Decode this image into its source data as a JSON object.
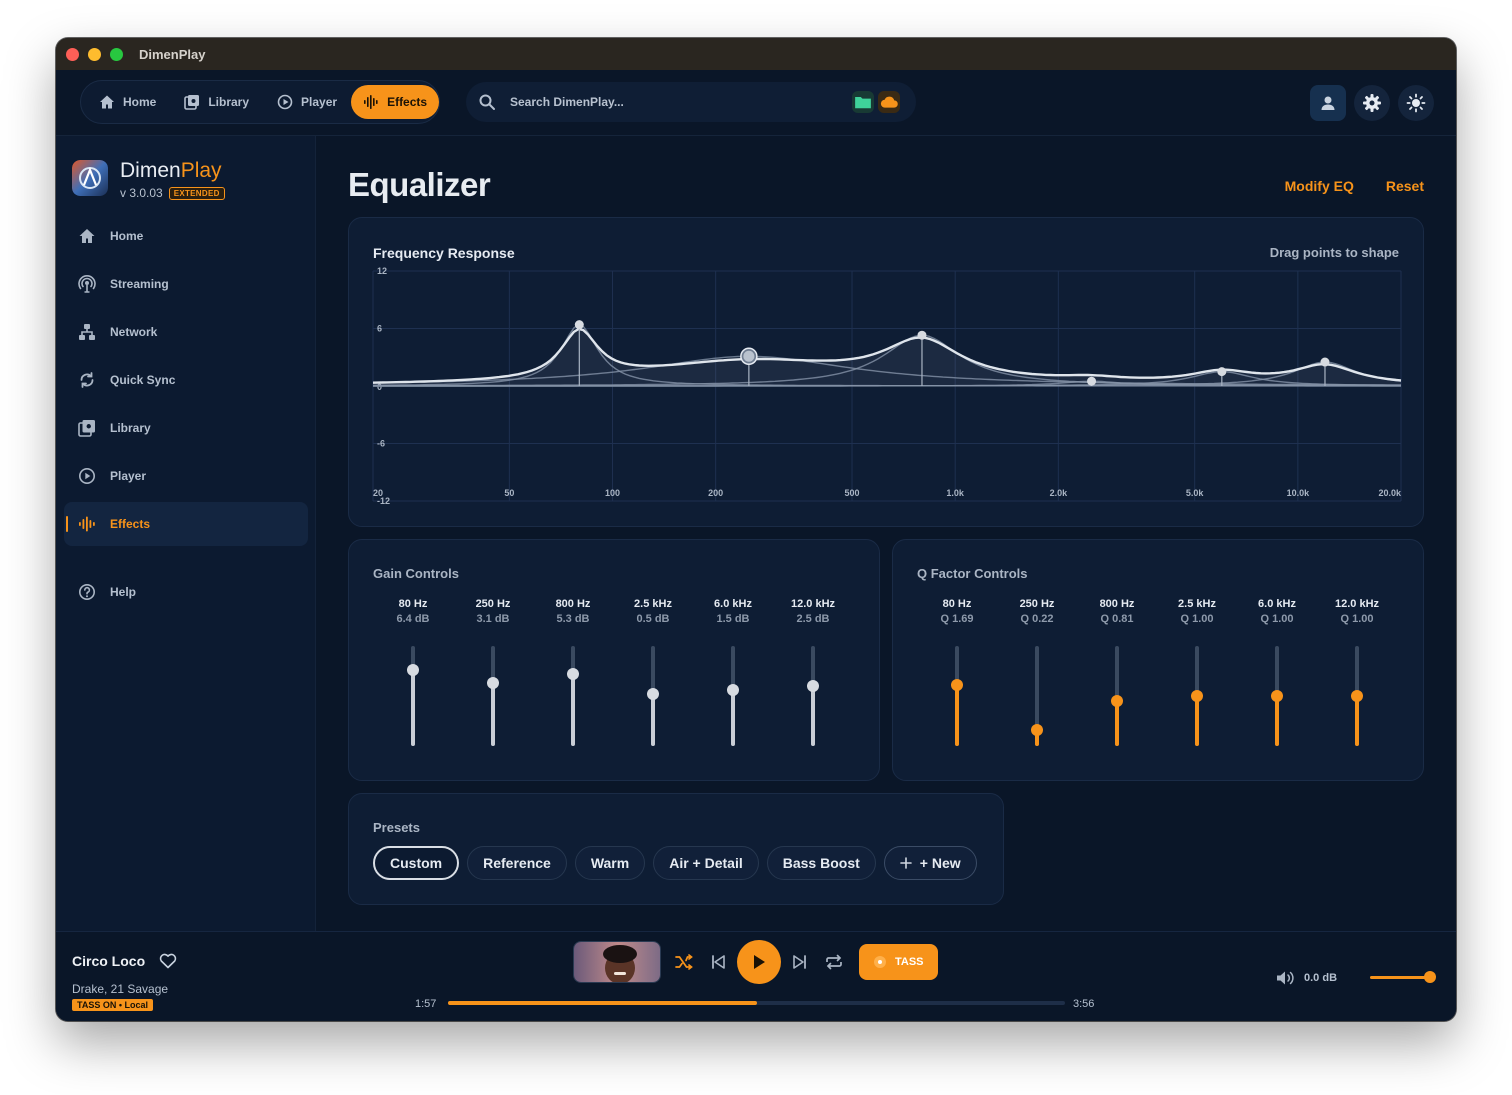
{
  "window": {
    "title": "DimenPlay"
  },
  "topnav": {
    "items": [
      {
        "label": "Home",
        "icon": "home-icon"
      },
      {
        "label": "Library",
        "icon": "library-icon"
      },
      {
        "label": "Player",
        "icon": "play-circle-icon"
      },
      {
        "label": "Effects",
        "icon": "waveform-icon",
        "active": true
      }
    ]
  },
  "search": {
    "placeholder": "Search DimenPlay..."
  },
  "brand": {
    "name_a": "Dimen",
    "name_b": "Play",
    "version": "v 3.0.03",
    "edition": "EXTENDED"
  },
  "sidebar": {
    "items": [
      {
        "label": "Home",
        "icon": "home-icon"
      },
      {
        "label": "Streaming",
        "icon": "broadcast-icon"
      },
      {
        "label": "Network",
        "icon": "network-icon"
      },
      {
        "label": "Quick Sync",
        "icon": "sync-icon"
      },
      {
        "label": "Library",
        "icon": "library-icon"
      },
      {
        "label": "Player",
        "icon": "play-circle-icon"
      },
      {
        "label": "Effects",
        "icon": "waveform-icon",
        "active": true
      },
      {
        "label": "Help",
        "icon": "help-icon"
      }
    ]
  },
  "page": {
    "title": "Equalizer",
    "modify": "Modify EQ",
    "reset": "Reset"
  },
  "freq": {
    "title": "Frequency Response",
    "hint": "Drag points to shape",
    "y_ticks": [
      "12",
      "6",
      "0",
      "-6",
      "-12"
    ],
    "x_ticks": [
      "20",
      "50",
      "100",
      "200",
      "500",
      "1.0k",
      "2.0k",
      "5.0k",
      "10.0k",
      "20.0k"
    ]
  },
  "chart_data": {
    "type": "line",
    "x_scale": "log",
    "xlim": [
      20,
      20000
    ],
    "ylim": [
      -12,
      12
    ],
    "y_ticks": [
      12,
      6,
      0,
      -6,
      -12
    ],
    "x_ticks": [
      20,
      50,
      100,
      200,
      500,
      1000,
      2000,
      5000,
      10000,
      20000
    ],
    "x_tick_labels": [
      "20",
      "50",
      "100",
      "200",
      "500",
      "1.0k",
      "2.0k",
      "5.0k",
      "10.0k",
      "20.0k"
    ],
    "grid": true,
    "bands": [
      {
        "freq": 80,
        "gain": 6.4,
        "q": 1.69
      },
      {
        "freq": 250,
        "gain": 3.1,
        "q": 0.22
      },
      {
        "freq": 800,
        "gain": 5.3,
        "q": 0.81
      },
      {
        "freq": 2500,
        "gain": 0.5,
        "q": 1.0
      },
      {
        "freq": 6000,
        "gain": 1.5,
        "q": 1.0
      },
      {
        "freq": 12000,
        "gain": 2.5,
        "q": 1.0
      }
    ]
  },
  "gain": {
    "title": "Gain Controls",
    "bands": [
      {
        "label": "80 Hz",
        "value": "6.4 dB",
        "level": 0.76
      },
      {
        "label": "250 Hz",
        "value": "3.1 dB",
        "level": 0.63
      },
      {
        "label": "800 Hz",
        "value": "5.3 dB",
        "level": 0.72
      },
      {
        "label": "2.5 kHz",
        "value": "0.5 dB",
        "level": 0.52
      },
      {
        "label": "6.0 kHz",
        "value": "1.5 dB",
        "level": 0.56
      },
      {
        "label": "12.0 kHz",
        "value": "2.5 dB",
        "level": 0.6
      }
    ]
  },
  "q": {
    "title": "Q Factor Controls",
    "bands": [
      {
        "label": "80 Hz",
        "value": "Q 1.69",
        "level": 0.61
      },
      {
        "label": "250 Hz",
        "value": "Q 0.22",
        "level": 0.16
      },
      {
        "label": "800 Hz",
        "value": "Q 0.81",
        "level": 0.45
      },
      {
        "label": "2.5 kHz",
        "value": "Q 1.00",
        "level": 0.5
      },
      {
        "label": "6.0 kHz",
        "value": "Q 1.00",
        "level": 0.5
      },
      {
        "label": "12.0 kHz",
        "value": "Q 1.00",
        "level": 0.5
      }
    ]
  },
  "presets": {
    "title": "Presets",
    "items": [
      "Custom",
      "Reference",
      "Warm",
      "Air + Detail",
      "Bass Boost"
    ],
    "new_label": "+ New"
  },
  "nowplaying": {
    "title": "Circo Loco",
    "artist": "Drake, 21 Savage",
    "badge": "TASS ON • Local",
    "elapsed": "1:57",
    "duration": "3:56",
    "progress": 0.5,
    "tass": "TASS",
    "volume": "0.0 dB",
    "volume_level": 1.0
  },
  "colors": {
    "accent": "#f7931a",
    "bg": "#0a1628",
    "panel": "#0e1d34"
  }
}
